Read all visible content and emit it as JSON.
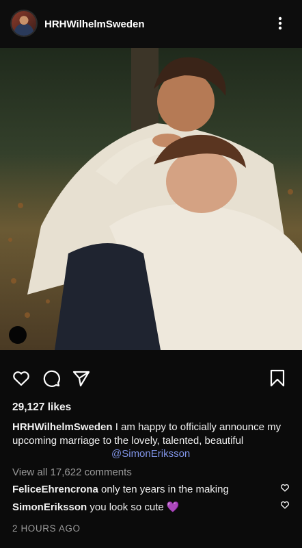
{
  "header": {
    "username": "HRHWilhelmSweden",
    "avatar_icon": "profile-photo",
    "more_icon": "more-vertical-icon"
  },
  "post": {
    "image_description_icon": "couple-photo",
    "likes": "29,127 likes",
    "caption_user": "HRHWilhelmSweden",
    "caption_text": " I am happy to officially announce my upcoming marriage to the lovely, talented, beautiful",
    "mention": "@SimonEriksson",
    "view_all": "View all 17,622  comments",
    "timestamp": "2 HOURS AGO"
  },
  "actions": {
    "like_icon": "heart-icon",
    "comment_icon": "comment-icon",
    "share_icon": "send-icon",
    "save_icon": "bookmark-icon"
  },
  "comments": [
    {
      "user": "FeliceEhrencrona",
      "text": " only ten years in the making"
    },
    {
      "user": "SimonEriksson",
      "text": " you look so cute 💜"
    }
  ],
  "colors": {
    "background": "#0b0b0b",
    "mention": "#7f93e6",
    "muted": "#9a9a9a"
  }
}
